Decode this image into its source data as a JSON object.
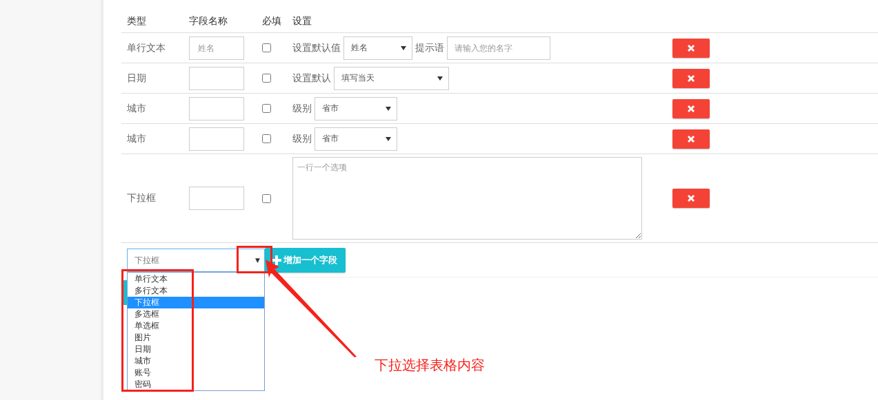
{
  "table": {
    "columns": [
      "类型",
      "字段名称",
      "必填",
      "设置"
    ],
    "rows": [
      {
        "kind": "text",
        "type": "单行文本",
        "name_placeholder": "姓名",
        "required": false,
        "settings": [
          {
            "kind": "label",
            "text": "设置默认值"
          },
          {
            "kind": "select",
            "value": "姓名"
          },
          {
            "kind": "label",
            "text": "提示语"
          },
          {
            "kind": "input",
            "placeholder": "请输入您的名字"
          }
        ]
      },
      {
        "kind": "date",
        "type": "日期",
        "required": false,
        "settings": [
          {
            "kind": "label",
            "text": "设置默认"
          },
          {
            "kind": "select",
            "value": "填写当天"
          }
        ]
      },
      {
        "kind": "city",
        "type": "城市",
        "required": false,
        "settings": [
          {
            "kind": "label",
            "text": "级别"
          },
          {
            "kind": "select",
            "value": "省市"
          }
        ]
      },
      {
        "kind": "city",
        "type": "城市",
        "required": false,
        "settings": [
          {
            "kind": "label",
            "text": "级别"
          },
          {
            "kind": "select",
            "value": "省市"
          }
        ]
      },
      {
        "kind": "dropdown",
        "type": "下拉框",
        "required": false,
        "settings": [
          {
            "kind": "textarea",
            "placeholder": "一行一个选项"
          }
        ]
      }
    ]
  },
  "add_field": {
    "type_select": {
      "value": "下拉框",
      "expanded": true,
      "arrow": "▼",
      "options": [
        {
          "label": "单行文本",
          "selected": false
        },
        {
          "label": "多行文本",
          "selected": false
        },
        {
          "label": "下拉框",
          "selected": true
        },
        {
          "label": "多选框",
          "selected": false
        },
        {
          "label": "单选框",
          "selected": false
        },
        {
          "label": "图片",
          "selected": false
        },
        {
          "label": "日期",
          "selected": false
        },
        {
          "label": "城市",
          "selected": false
        },
        {
          "label": "账号",
          "selected": false
        },
        {
          "label": "密码",
          "selected": false
        }
      ]
    },
    "button": "增加一个字段"
  },
  "annotation": {
    "text": "下拉选择表格内容"
  }
}
